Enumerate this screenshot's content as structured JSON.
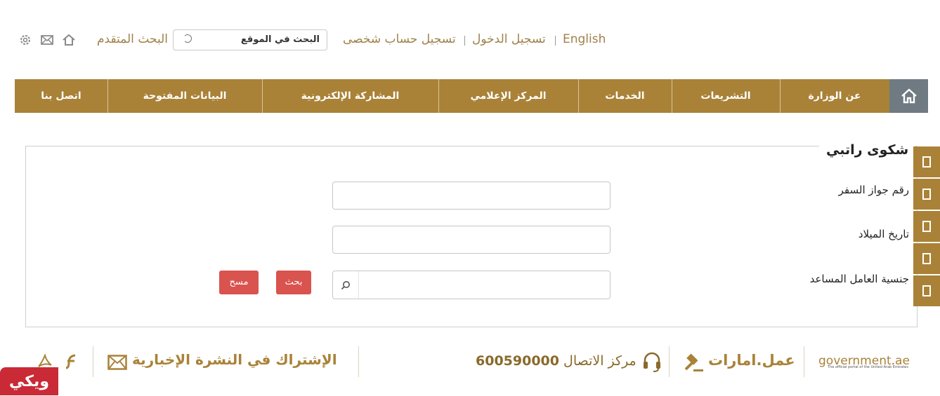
{
  "top_bar": {
    "english_label": "English",
    "login_label": "تسجيل الدخول",
    "register_label": "تسجيل حساب شخصى",
    "search_placeholder": "البحث في الموقع",
    "advanced_search_label": "البحث المتقدم",
    "icons": [
      "home-icon",
      "mail-icon",
      "gear-icon"
    ]
  },
  "nav": {
    "items": [
      {
        "label": "عن الوزارة"
      },
      {
        "label": "التشريعات"
      },
      {
        "label": "الخدمات"
      },
      {
        "label": "المركز الإعلامي"
      },
      {
        "label": "المشاركة الإلكترونية"
      },
      {
        "label": "البيانات المفتوحة"
      },
      {
        "label": "اتصل بنا"
      }
    ],
    "colors": {
      "bar": "#a98238",
      "home": "#6f7a82"
    }
  },
  "form": {
    "title": "شكوى راتبي",
    "fields": [
      {
        "label": "رقم جواز السفر",
        "value": ""
      },
      {
        "label": "تاريخ الميلاد",
        "value": ""
      },
      {
        "label": "جنسية العامل المساعد",
        "value": ""
      }
    ],
    "search_button": "بحث",
    "clear_button": "مسح"
  },
  "footer": {
    "gov_logo_main": "government",
    "gov_logo_dot": ".",
    "gov_logo_tld": "ae",
    "gov_logo_sub": "The official portal of the United Arab Emirates",
    "amal_label": "عمل.امارات",
    "contact_label": "مركز الاتصال",
    "contact_number": "600590000",
    "newsletter_label": "الإشتراك في النشرة الإخبارية",
    "watermark": "ويكي"
  },
  "accent_color": "#a98238",
  "button_color": "#d9534f"
}
